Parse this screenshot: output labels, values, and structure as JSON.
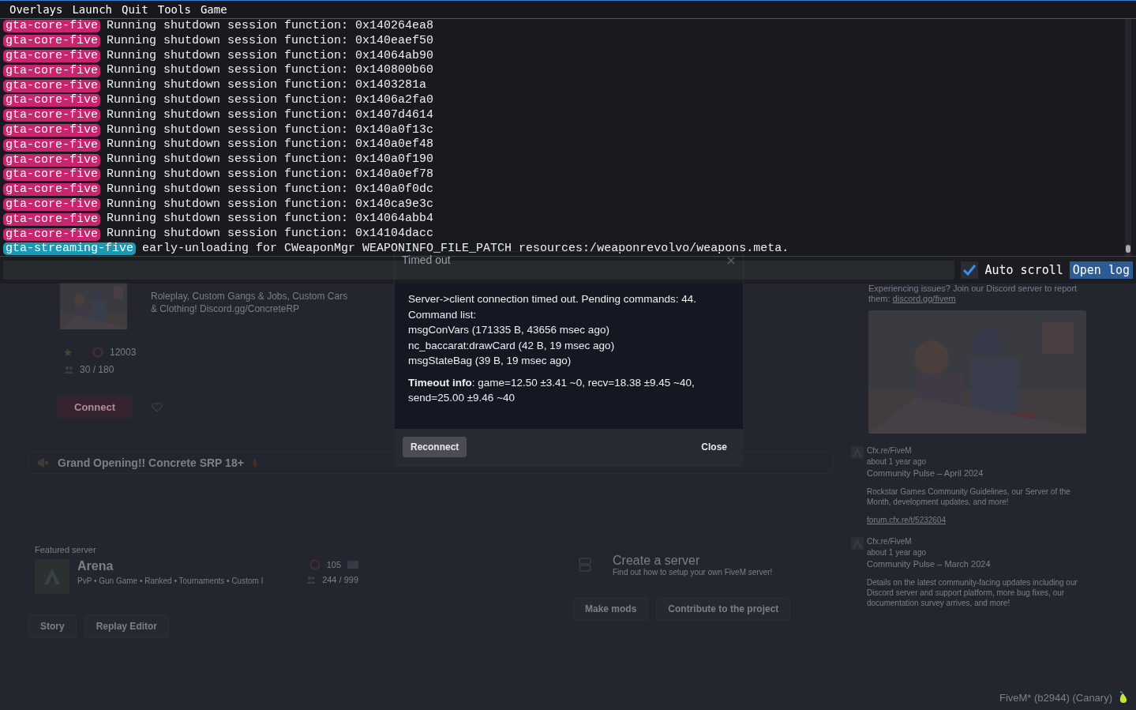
{
  "menu_bar": {
    "items": [
      "Overlays",
      "Launch",
      "Quit",
      "Tools",
      "Game"
    ]
  },
  "console": {
    "lines": [
      {
        "tag": "gta-core-five",
        "color": "#c8256f",
        "text": "Running shutdown session function: 0x140264ea8"
      },
      {
        "tag": "gta-core-five",
        "color": "#c8256f",
        "text": "Running shutdown session function: 0x140eaef50"
      },
      {
        "tag": "gta-core-five",
        "color": "#c8256f",
        "text": "Running shutdown session function: 0x14064ab90"
      },
      {
        "tag": "gta-core-five",
        "color": "#c8256f",
        "text": "Running shutdown session function: 0x140800b60"
      },
      {
        "tag": "gta-core-five",
        "color": "#c8256f",
        "text": "Running shutdown session function: 0x1403281a"
      },
      {
        "tag": "gta-core-five",
        "color": "#c8256f",
        "text": "Running shutdown session function: 0x1406a2fa0"
      },
      {
        "tag": "gta-core-five",
        "color": "#c8256f",
        "text": "Running shutdown session function: 0x1407d4614"
      },
      {
        "tag": "gta-core-five",
        "color": "#c8256f",
        "text": "Running shutdown session function: 0x140a0f13c"
      },
      {
        "tag": "gta-core-five",
        "color": "#c8256f",
        "text": "Running shutdown session function: 0x140a0ef48"
      },
      {
        "tag": "gta-core-five",
        "color": "#c8256f",
        "text": "Running shutdown session function: 0x140a0f190"
      },
      {
        "tag": "gta-core-five",
        "color": "#c8256f",
        "text": "Running shutdown session function: 0x140a0ef78"
      },
      {
        "tag": "gta-core-five",
        "color": "#c8256f",
        "text": "Running shutdown session function: 0x140a0f0dc"
      },
      {
        "tag": "gta-core-five",
        "color": "#c8256f",
        "text": "Running shutdown session function: 0x140ca9e3c"
      },
      {
        "tag": "gta-core-five",
        "color": "#c8256f",
        "text": "Running shutdown session function: 0x14064abb4"
      },
      {
        "tag": "gta-core-five",
        "color": "#c8256f",
        "text": "Running shutdown session function: 0x14104dacc"
      },
      {
        "tag": "gta-streaming-five",
        "color": "#1d98b3",
        "text": "early-unloading for CWeaponMgr WEAPONINFO_FILE_PATCH resources:/weaponrevolvo/weapons.meta."
      }
    ],
    "auto_scroll": {
      "label": "Auto scroll",
      "checked": true
    },
    "open_log": "Open log"
  },
  "dialog": {
    "title": "Timed out",
    "lines": [
      "Server->client connection timed out. Pending commands: 44.",
      "Command list:",
      "msgConVars (171335 B, 43656 msec ago)",
      "nc_baccarat:drawCard (42 B, 19 msec ago)",
      "msgStateBag (39 B, 19 msec ago)"
    ],
    "timeout_info": "**Timeout info**: game=12.50 ±3.41 ~0, recv=18.38 ±9.45 ~40, send=25.00 ±9.46 ~40",
    "reconnect": "Reconnect",
    "close": "Close"
  },
  "launcher": {
    "server_card": {
      "description": "Roleplay, Custom Gangs & Jobs, Custom Cars & Clothing! Discord.gg/ConcreteRP",
      "boosts": "12003",
      "players": "30 / 180",
      "connect": "Connect"
    },
    "banner": "Grand Opening!! Concrete SRP 18+",
    "featured": {
      "heading": "Featured server",
      "name": "Arena",
      "tags": "PvP • Gun Game • Ranked • Tournaments • Custom I",
      "boosts": "105",
      "players": "244 / 999"
    },
    "create_server": {
      "title": "Create a server",
      "subtitle": "Find out how to setup your own FiveM server!"
    },
    "left_buttons": [
      "Story",
      "Replay Editor"
    ],
    "right_buttons": [
      "Make mods",
      "Contribute to the project"
    ],
    "notice": "Experiencing issues? Join our Discord server to report them: ",
    "notice_link": "discord.gg/fivem",
    "news": [
      {
        "author": "Cfx.re/FiveM",
        "time": "about 1 year ago",
        "title": "Community Pulse – April 2024",
        "body": "Rockstar Games Community Guidelines, our Server of the Month, development updates, and more!",
        "link": "forum.cfx.re/t/5232604"
      },
      {
        "author": "Cfx.re/FiveM",
        "time": "about 1 year ago",
        "title": "Community Pulse – March 2024",
        "body": "Details on the latest community-facing updates including our Discord server and support platform, more bug fixes, our documentation survey arrives, and more!"
      }
    ]
  },
  "version": "FiveM* (b2944) (Canary)"
}
